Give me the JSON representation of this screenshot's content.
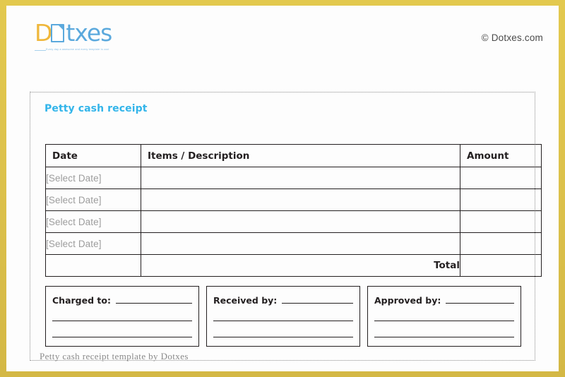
{
  "document": {
    "title": "Petty cash receipt",
    "footer_note": "Petty cash receipt template by Dotxes"
  },
  "header": {
    "logo": {
      "wordmark_part_1": "D",
      "icon": "document-icon",
      "wordmark_part_2": "txes",
      "tagline": "Every day a awesome and every template is cool",
      "amber_color": "#efb73b",
      "blue_color": "#5ba9dd"
    },
    "copyright": "© Dotxes.com"
  },
  "table": {
    "columns": [
      {
        "key": "date",
        "label": "Date"
      },
      {
        "key": "description",
        "label": "Items / Description"
      },
      {
        "key": "amount",
        "label": "Amount"
      }
    ],
    "rows": [
      {
        "date": "[Select Date]",
        "description": "",
        "amount": ""
      },
      {
        "date": "[Select Date]",
        "description": "",
        "amount": ""
      },
      {
        "date": "[Select Date]",
        "description": "",
        "amount": ""
      },
      {
        "date": "[Select Date]",
        "description": "",
        "amount": ""
      }
    ],
    "total": {
      "label": "Total",
      "value": ""
    }
  },
  "signatures": [
    {
      "label": "Charged to:",
      "value": "",
      "line_2": "",
      "line_3": ""
    },
    {
      "label": "Received by:",
      "value": "",
      "line_2": "",
      "line_3": ""
    },
    {
      "label": "Approved by:",
      "value": "",
      "line_2": "",
      "line_3": ""
    }
  ],
  "theme": {
    "frame_color": "#dcc14b",
    "title_color": "#33b5ea",
    "placeholder_color": "#9d9d9d",
    "rule_color": "#231f20",
    "sheet_color": "#fdfdfd"
  }
}
